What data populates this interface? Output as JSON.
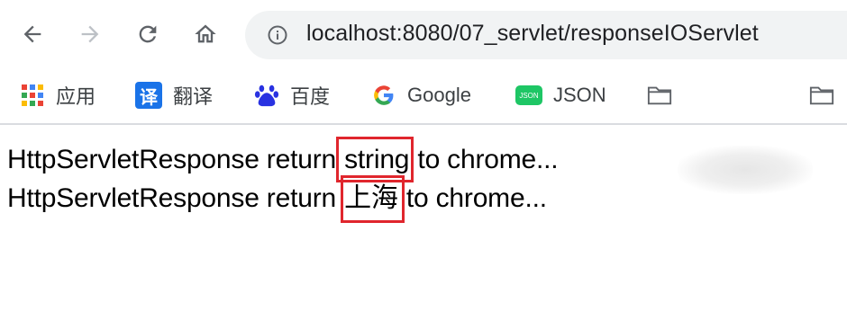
{
  "toolbar": {
    "back_icon": "arrow-left-icon",
    "forward_icon": "arrow-right-icon",
    "reload_icon": "reload-icon",
    "home_icon": "home-icon",
    "url": "localhost:8080/07_servlet/responseIOServlet"
  },
  "bookmarks": {
    "items": [
      {
        "label": "应用",
        "icon": "apps-grid-icon"
      },
      {
        "label": "翻译",
        "icon": "translate-icon",
        "icon_text": "译"
      },
      {
        "label": "百度",
        "icon": "baidu-paw-icon",
        "icon_text": "du"
      },
      {
        "label": "Google",
        "icon": "google-g-icon",
        "icon_text": "G"
      },
      {
        "label": "JSON",
        "icon": "json-icon",
        "icon_text": "JSON"
      },
      {
        "label": "",
        "icon": "folder-icon"
      },
      {
        "label": "",
        "icon": "folder-icon"
      }
    ]
  },
  "content": {
    "line1": {
      "prefix": "HttpServletResponse return ",
      "highlight": "string",
      "suffix": " to chrome..."
    },
    "line2": {
      "prefix": "HttpServletResponse return ",
      "highlight": "上海",
      "suffix": " to chrome..."
    }
  },
  "colors": {
    "highlight_box": "#e0262d",
    "omnibox_bg": "#f1f3f4",
    "translate_blue": "#1a73e8",
    "baidu_blue": "#2932e1",
    "json_green": "#1ec665"
  }
}
